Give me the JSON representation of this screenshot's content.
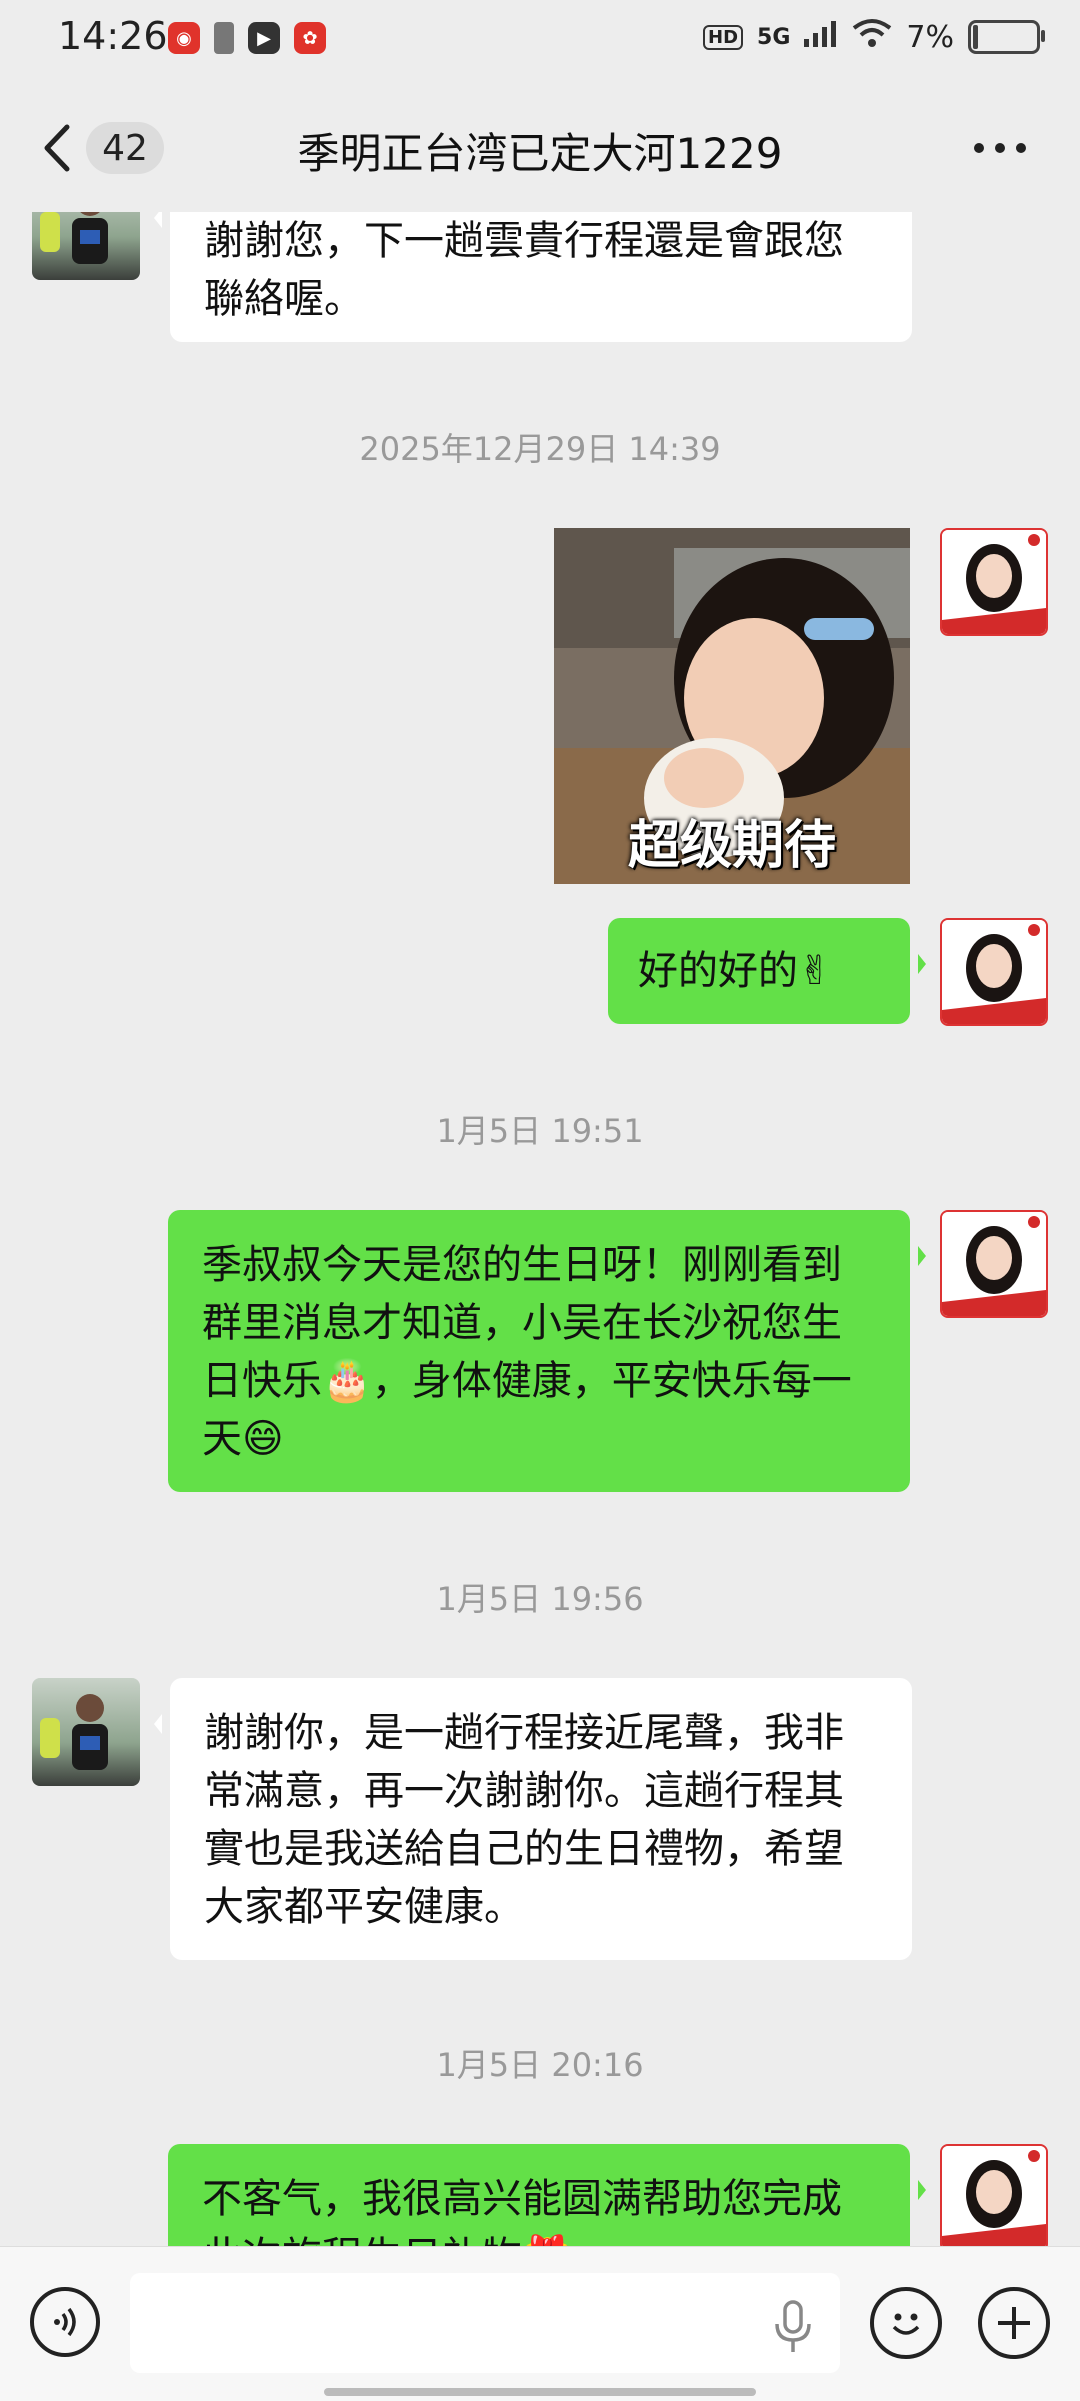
{
  "status_bar": {
    "time": "14:26",
    "hd": "HD",
    "network": "5G",
    "battery": "7%"
  },
  "header": {
    "back_icon": "chevron-left-icon",
    "unread_count": "42",
    "title": "季明正台湾已定大河1229",
    "more_icon": "more-dots-icon"
  },
  "messages": [
    {
      "type": "text",
      "side": "left",
      "text": "謝謝您，下一趟雲貴行程還是會跟您聯絡喔。"
    },
    {
      "type": "timestamp",
      "text": "2025年12月29日 14:39"
    },
    {
      "type": "sticker",
      "side": "right",
      "caption": "超级期待"
    },
    {
      "type": "text",
      "side": "right",
      "text": "好的好的✌"
    },
    {
      "type": "timestamp",
      "text": "1月5日 19:51"
    },
    {
      "type": "text",
      "side": "right",
      "text": "季叔叔今天是您的生日呀！刚刚看到群里消息才知道，小吴在长沙祝您生日快乐🎂，身体健康，平安快乐每一天😄"
    },
    {
      "type": "timestamp",
      "text": "1月5日 19:56"
    },
    {
      "type": "text",
      "side": "left",
      "text": "謝謝你，是一趟行程接近尾聲，我非常滿意，再一次謝謝你。這趟行程其實也是我送給自己的生日禮物，希望大家都平安健康。"
    },
    {
      "type": "timestamp",
      "text": "1月5日 20:16"
    },
    {
      "type": "text",
      "side": "right",
      "text": "不客气，我很高兴能圆满帮助您完成此次旅程生日礼物🎁"
    }
  ],
  "input_bar": {
    "value": "",
    "voice_icon": "voice-mode-icon",
    "mic_icon": "microphone-icon",
    "emoji_icon": "emoji-icon",
    "plus_icon": "plus-icon"
  },
  "colors": {
    "background": "#ededed",
    "bubble_self": "#63e048",
    "bubble_other": "#ffffff",
    "timestamp": "#999999"
  }
}
